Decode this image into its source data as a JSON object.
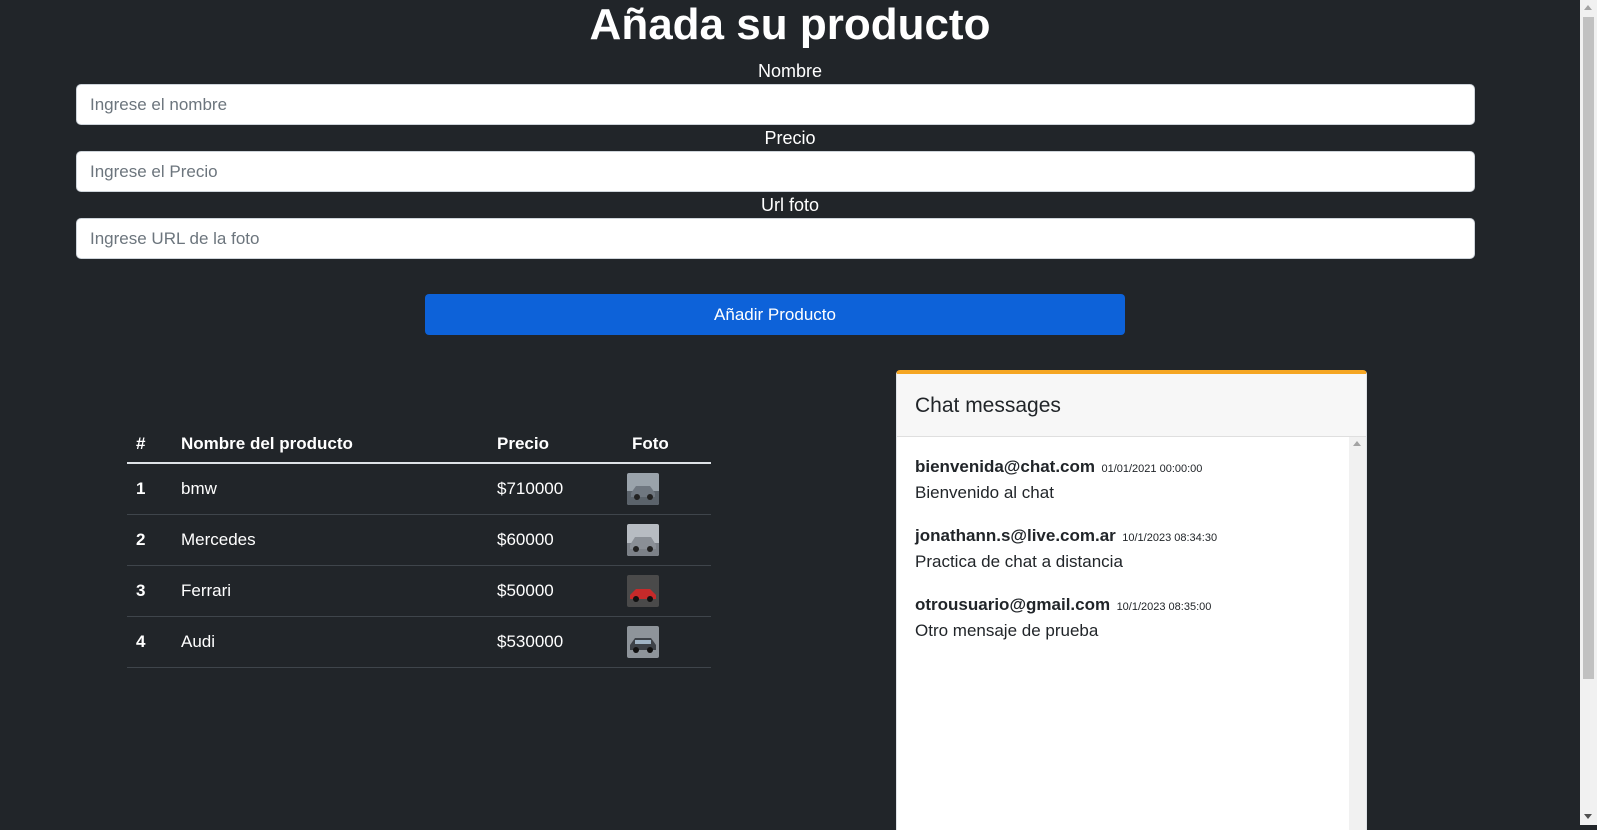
{
  "form": {
    "title": "Añada su producto",
    "name_label": "Nombre",
    "name_placeholder": "Ingrese el nombre",
    "price_label": "Precio",
    "price_placeholder": "Ingrese el Precio",
    "photo_label": "Url foto",
    "photo_placeholder": "Ingrese URL de la foto",
    "submit_label": "Añadir Producto"
  },
  "table": {
    "headers": [
      "#",
      "Nombre del producto",
      "Precio",
      "Foto"
    ],
    "rows": [
      {
        "index": "1",
        "name": "bmw",
        "price": "$710000",
        "photo_icon": "car-photo-gray",
        "photo_color": "#6f7780"
      },
      {
        "index": "2",
        "name": "Mercedes",
        "price": "$60000",
        "photo_icon": "car-photo-silver",
        "photo_color": "#8a8f96"
      },
      {
        "index": "3",
        "name": "Ferrari",
        "price": "$50000",
        "photo_icon": "car-photo-red",
        "photo_color": "#c62a2a"
      },
      {
        "index": "4",
        "name": "Audi",
        "price": "$530000",
        "photo_icon": "car-photo-dark",
        "photo_color": "#4a4f55"
      }
    ]
  },
  "chat": {
    "title": "Chat messages",
    "accent_color": "#f5a623",
    "messages": [
      {
        "user": "bienvenida@chat.com",
        "time": "01/01/2021 00:00:00",
        "text": "Bienvenido al chat"
      },
      {
        "user": "jonathann.s@live.com.ar",
        "time": "10/1/2023 08:34:30",
        "text": "Practica de chat a distancia"
      },
      {
        "user": "otrousuario@gmail.com",
        "time": "10/1/2023 08:35:00",
        "text": "Otro mensaje de prueba"
      }
    ]
  },
  "colors": {
    "background": "#212529",
    "primary_button": "#0d62d9"
  }
}
